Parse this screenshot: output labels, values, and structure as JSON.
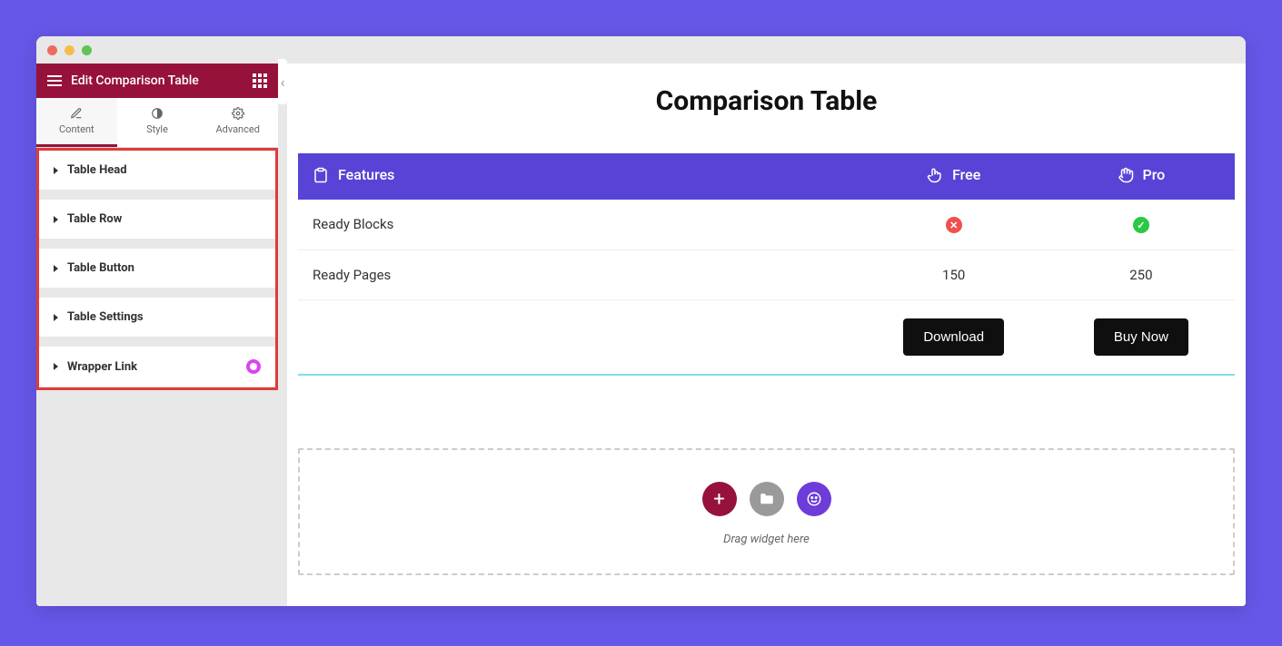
{
  "sidebar": {
    "title": "Edit Comparison Table",
    "tabs": [
      {
        "label": "Content"
      },
      {
        "label": "Style"
      },
      {
        "label": "Advanced"
      }
    ],
    "sections": [
      {
        "label": "Table Head"
      },
      {
        "label": "Table Row"
      },
      {
        "label": "Table Button"
      },
      {
        "label": "Table Settings"
      },
      {
        "label": "Wrapper Link",
        "hasBadge": true
      }
    ]
  },
  "main": {
    "title": "Comparison Table",
    "table_head": {
      "feature_col": "Features",
      "col1": "Free",
      "col2": "Pro"
    },
    "rows": [
      {
        "label": "Ready Blocks",
        "col1_type": "cross",
        "col2_type": "check"
      },
      {
        "label": "Ready Pages",
        "col1_value": "150",
        "col2_value": "250"
      }
    ],
    "buttons": {
      "col1": "Download",
      "col2": "Buy Now"
    }
  },
  "drop_zone": {
    "hint": "Drag widget here"
  }
}
